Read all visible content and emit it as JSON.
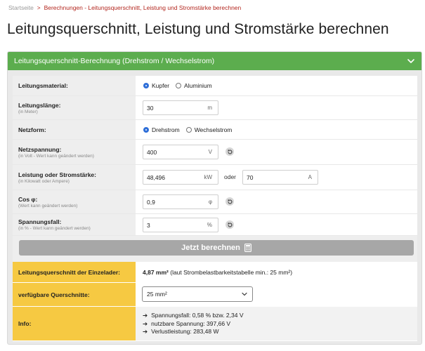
{
  "breadcrumb": {
    "home": "Startseite",
    "separator": ">",
    "current": "Berechnungen - Leitungsquerschnitt, Leistung und Stromstärke berechnen"
  },
  "page_title": "Leitungsquerschnitt, Leistung und Stromstärke berechnen",
  "panel": {
    "title": "Leitungsquerschnitt-Berechnung (Drehstrom / Wechselstrom)",
    "header_color": "#5cad4e"
  },
  "form": {
    "material": {
      "label": "Leitungsmaterial:",
      "options": [
        "Kupfer",
        "Aluminium"
      ],
      "selected": "Kupfer"
    },
    "length": {
      "label": "Leitungslänge:",
      "hint": "(in Meter)",
      "value": "30",
      "unit": "m"
    },
    "netzform": {
      "label": "Netzform:",
      "options": [
        "Drehstrom",
        "Wechselstrom"
      ],
      "selected": "Drehstrom"
    },
    "voltage": {
      "label": "Netzspannung:",
      "hint": "(in Volt - Wert kann geändert werden)",
      "value": "400",
      "unit": "V"
    },
    "power": {
      "label": "Leistung oder Stromstärke:",
      "hint": "(in Kilowatt oder Ampere)",
      "power_value": "48,496",
      "power_unit": "kW",
      "or_text": "oder",
      "current_value": "70",
      "current_unit": "A"
    },
    "cosphi": {
      "label": "Cos φ:",
      "hint": "(Wert kann geändert werden)",
      "value": "0,9",
      "unit": "φ"
    },
    "drop": {
      "label": "Spannungsfall:",
      "hint": "(in % - Wert kann geändert werden)",
      "value": "3",
      "unit": "%"
    }
  },
  "calc_button": {
    "label": "Jetzt berechnen",
    "icon": "calculator-icon",
    "color": "#a7a7a7"
  },
  "results": {
    "accent_color": "#f6c942",
    "cross_section": {
      "label": "Leitungsquerschnitt der Einzelader:",
      "value": "4,87 mm²",
      "note": "(laut Strombelastbarkeitstabelle min.: 25 mm²)"
    },
    "available": {
      "label": "verfügbare Querschnitte:",
      "selected": "25 mm²"
    },
    "info": {
      "label": "Info:",
      "items": [
        "Spannungsfall: 0,58 % bzw. 2,34 V",
        "nutzbare Spannung: 397,66 V",
        "Verlustleistung: 283,48 W"
      ]
    }
  }
}
